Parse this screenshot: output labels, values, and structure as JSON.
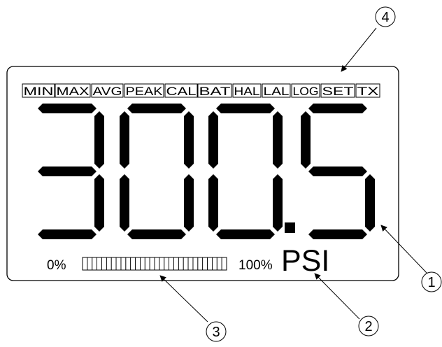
{
  "indicators": [
    "MIN",
    "MAX",
    "AVG",
    "PEAK",
    "CAL",
    "BAT",
    "HAL",
    "LAL",
    "LOG",
    "SET",
    "TX"
  ],
  "reading": "300.5",
  "reading_digits": [
    "3",
    "0",
    "0",
    "5"
  ],
  "unit": "PSI",
  "bargraph": {
    "min_label": "0%",
    "max_label": "100%",
    "segment_count": 30,
    "lit_fraction": 0
  },
  "callouts": [
    {
      "number": "1",
      "target": "lcd-display"
    },
    {
      "number": "2",
      "target": "unit-label"
    },
    {
      "number": "3",
      "target": "bargraph"
    },
    {
      "number": "4",
      "target": "indicator-row"
    }
  ]
}
